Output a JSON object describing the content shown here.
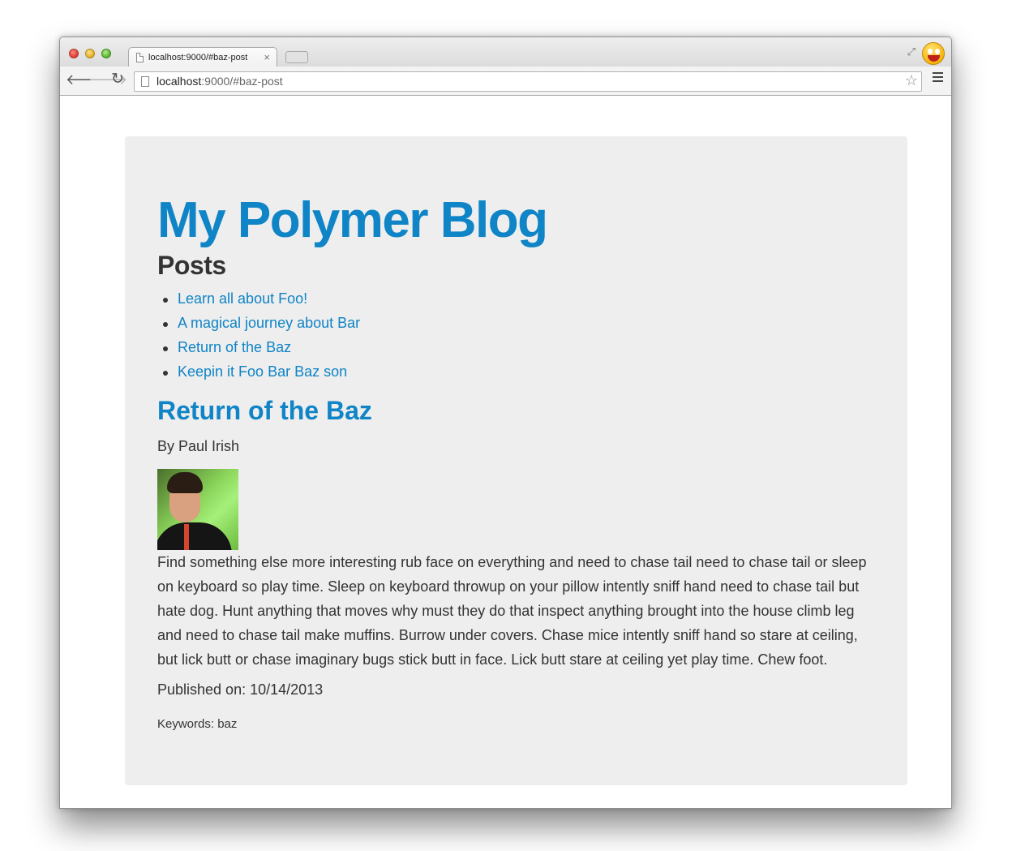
{
  "browser": {
    "tab": {
      "title": "localhost:9000/#baz-post",
      "close_glyph": "×"
    },
    "address_bar": {
      "host": "localhost",
      "path": ":9000/#baz-post"
    },
    "icons": {
      "back": "back-arrow-icon",
      "forward": "forward-arrow-icon",
      "reload": "reload-icon",
      "bookmark": "star-icon",
      "menu": "hamburger-menu-icon",
      "profile": "profile-avatar-icon",
      "fullscreen": "fullscreen-icon"
    }
  },
  "page": {
    "blog_title": "My Polymer Blog",
    "posts_heading": "Posts",
    "posts": [
      "Learn all about Foo!",
      "A magical journey about Bar",
      "Return of the Baz",
      "Keepin it Foo Bar Baz son"
    ],
    "post": {
      "title": "Return of the Baz",
      "byline": "By Paul Irish",
      "body": "Find something else more interesting rub face on everything and need to chase tail need to chase tail or sleep on keyboard so play time. Sleep on keyboard throwup on your pillow intently sniff hand need to chase tail but hate dog. Hunt anything that moves why must they do that inspect anything brought into the house climb leg and need to chase tail make muffins. Burrow under covers. Chase mice intently sniff hand so stare at ceiling, but lick butt or chase imaginary bugs stick butt in face. Lick butt stare at ceiling yet play time. Chew foot.",
      "published": "Published on: 10/14/2013",
      "keywords": "Keywords: baz"
    }
  },
  "colors": {
    "link": "#0f84c6",
    "text": "#333333",
    "card_bg": "#eeeeee"
  }
}
